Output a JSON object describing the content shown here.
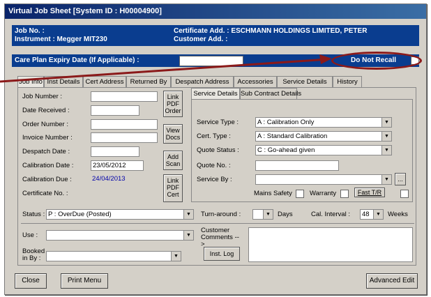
{
  "window": {
    "title": "Virtual Job Sheet [System ID : H00004900]"
  },
  "header": {
    "job_no_label": "Job No. :",
    "instrument_label": "Instrument : Megger MIT230",
    "certificate_add_label": "Certificate Add. : ESCHMANN HOLDINGS LIMITED, PETER",
    "customer_add_label": "Customer Add. :"
  },
  "care_plan": {
    "label": "Care Plan Expiry Date (If Applicable) :",
    "value": "",
    "do_not_recall_label": "Do Not Recall"
  },
  "tabs": [
    {
      "label": "Job Info"
    },
    {
      "label": "Inst Details"
    },
    {
      "label": "Cert Address"
    },
    {
      "label": "Returned By"
    },
    {
      "label": "Despatch Address"
    },
    {
      "label": "Accessories"
    },
    {
      "label": "Service Details"
    },
    {
      "label": "History"
    }
  ],
  "job_info": {
    "job_number_label": "Job Number :",
    "date_received_label": "Date Received :",
    "order_number_label": "Order Number :",
    "invoice_number_label": "Invoice Number :",
    "despatch_date_label": "Despatch Date :",
    "calibration_date_label": "Calibration Date :",
    "calibration_date_value": "23/05/2012",
    "calibration_due_label": "Calibration Due :",
    "calibration_due_value": "24/04/2013",
    "certificate_no_label": "Certificate No. :",
    "link_pdf_order": "Link PDF Order",
    "view_docs": "View Docs",
    "add_scan": "Add Scan",
    "link_pdf_cert": "Link PDF Cert"
  },
  "service": {
    "subtabs": [
      {
        "label": "Service Details"
      },
      {
        "label": "Sub Contract Details"
      }
    ],
    "service_type_label": "Service Type :",
    "service_type_value": "A : Calibration Only",
    "cert_type_label": "Cert. Type :",
    "cert_type_value": "A : Standard Calibration",
    "quote_status_label": "Quote Status :",
    "quote_status_value": "C : Go-ahead given",
    "quote_no_label": "Quote No. :",
    "service_by_label": "Service By :",
    "service_by_button": "...",
    "mains_safety_label": "Mains Safety",
    "warranty_label": "Warranty",
    "fast_tr_label": "Fast T/R"
  },
  "status": {
    "status_label": "Status :",
    "status_value": "P : OverDue (Posted)",
    "turnaround_label": "Turn-around :",
    "days_label": "Days",
    "cal_interval_label": "Cal. Interval :",
    "cal_interval_value": "48",
    "weeks_label": "Weeks"
  },
  "misc": {
    "use_label": "Use :",
    "booked_in_by_label": "Booked in By :",
    "customer_comments_label": "Customer Comments -->",
    "inst_log_button": "Inst. Log"
  },
  "footer": {
    "close_button": "Close",
    "print_menu_button": "Print Menu",
    "advanced_edit_button": "Advanced Edit"
  },
  "colors": {
    "accent": "#0a3d8f",
    "annotation": "#8b1a1a",
    "date_blue": "#0000aa"
  }
}
